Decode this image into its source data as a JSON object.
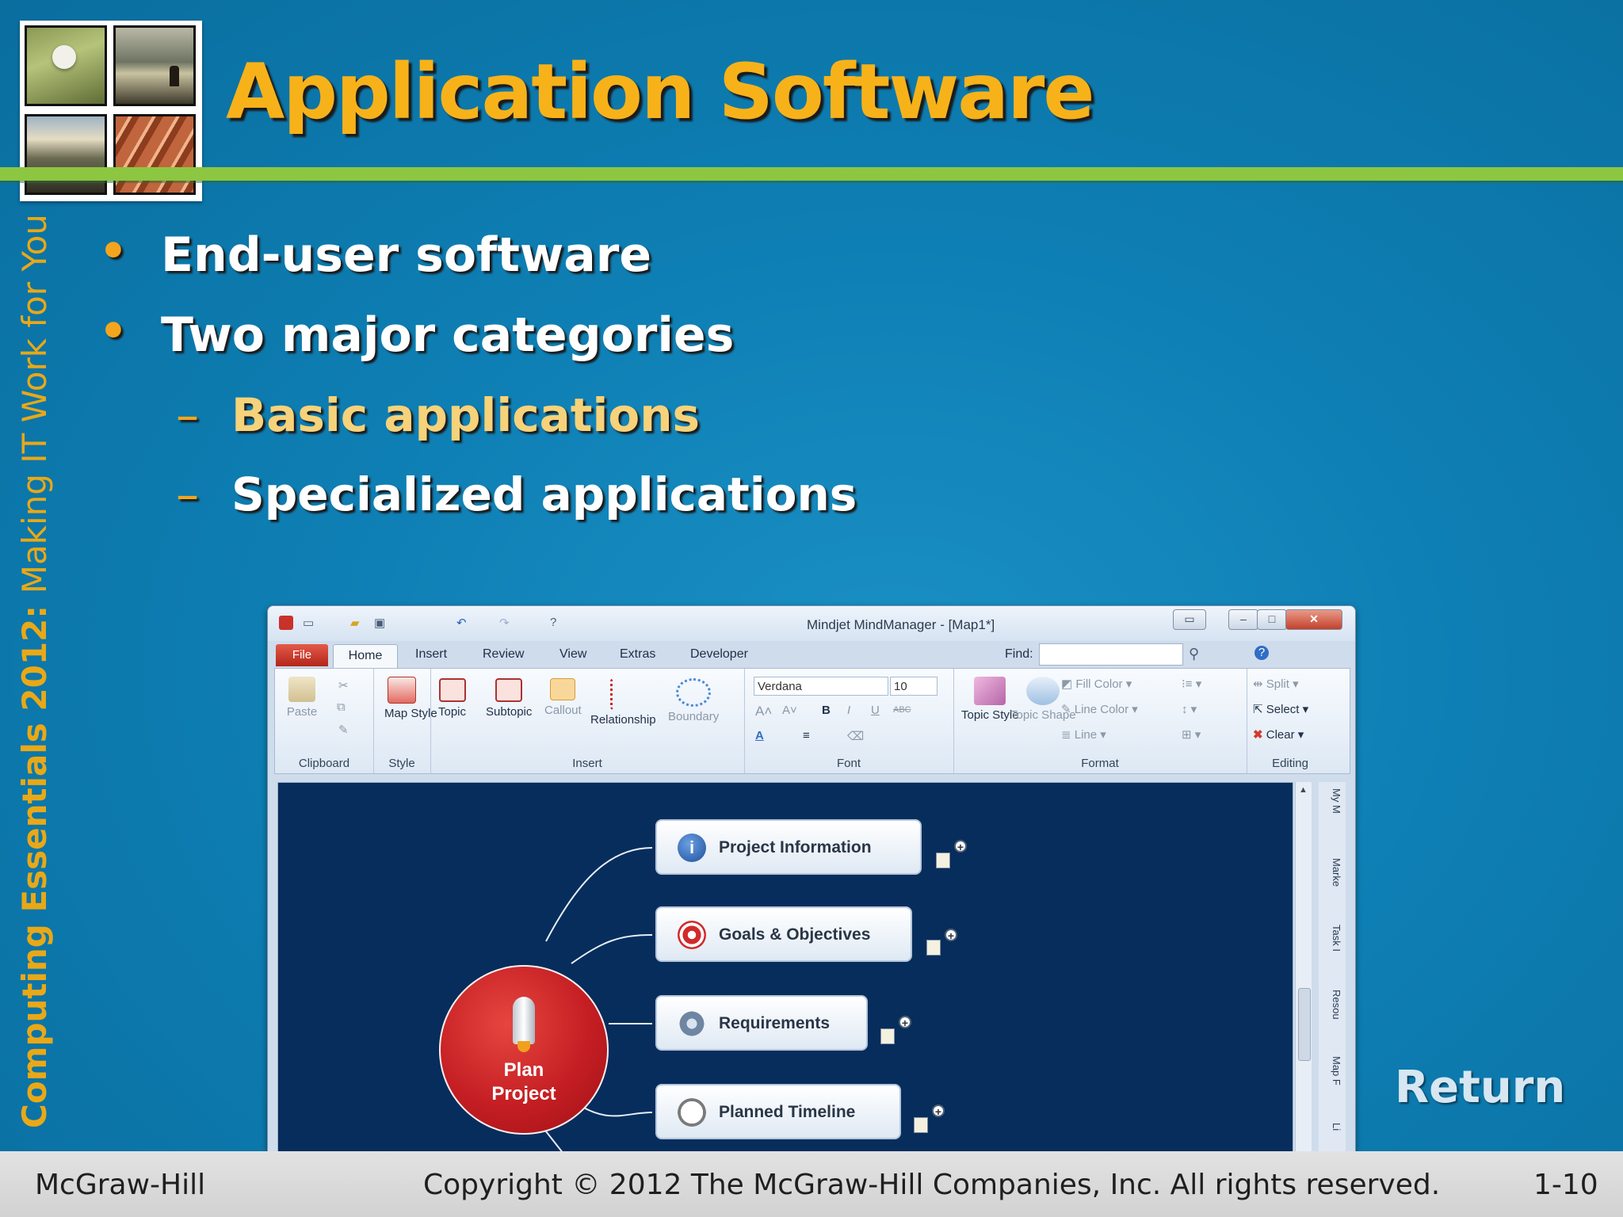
{
  "slide": {
    "title": "Application Software",
    "vertical_bold": "Computing Essentials 2012:",
    "vertical_light": "Making IT Work for You",
    "bullets": [
      {
        "text": "End-user software"
      },
      {
        "text": "Two major categories"
      }
    ],
    "sub_bullets": [
      {
        "text": "Basic applications"
      },
      {
        "text": "Specialized applications"
      }
    ],
    "bullet_glyph": "•",
    "dash_glyph": "–",
    "return_link": "Return",
    "footer": {
      "left": "McGraw-Hill",
      "center": "Copyright © 2012 The McGraw-Hill Companies, Inc. All rights reserved.",
      "right": "1-10"
    },
    "colors": {
      "title": "#f7b21a",
      "accent_bar": "#8dc641",
      "background": "#0e7fb4",
      "sub_bullet_highlight": "#f6d27a"
    }
  },
  "app_window": {
    "title": "Mindjet MindManager - [Map1*]",
    "tabs": [
      "File",
      "Home",
      "Insert",
      "Review",
      "View",
      "Extras",
      "Developer"
    ],
    "active_tab": "Home",
    "find_label": "Find:",
    "ribbon": {
      "groups": [
        {
          "label": "Clipboard",
          "buttons": [
            "Paste"
          ]
        },
        {
          "label": "Style",
          "buttons": [
            "Map Style"
          ]
        },
        {
          "label": "Insert",
          "buttons": [
            "Topic",
            "Subtopic",
            "Callout",
            "Relationship",
            "Boundary"
          ]
        },
        {
          "label": "Font",
          "font_name": "Verdana",
          "font_size": "10",
          "buttons": [
            "B",
            "I",
            "U",
            "ABC"
          ]
        },
        {
          "label": "Format",
          "buttons": [
            "Topic Style",
            "Topic Shape",
            "Fill Color",
            "Line Color",
            "Line"
          ]
        },
        {
          "label": "Editing",
          "buttons": [
            "Split",
            "Select",
            "Clear"
          ]
        }
      ]
    },
    "side_tabs": [
      "My M",
      "Marke",
      "Task I",
      "Resou",
      "Map F",
      "Li"
    ],
    "mindmap": {
      "central_topic": [
        "Plan",
        "Project"
      ],
      "topics": [
        "Project Information",
        "Goals & Objectives",
        "Requirements",
        "Planned Timeline"
      ],
      "topic_icons": [
        "info-icon",
        "target-icon",
        "gears-icon",
        "clock-icon"
      ]
    }
  }
}
